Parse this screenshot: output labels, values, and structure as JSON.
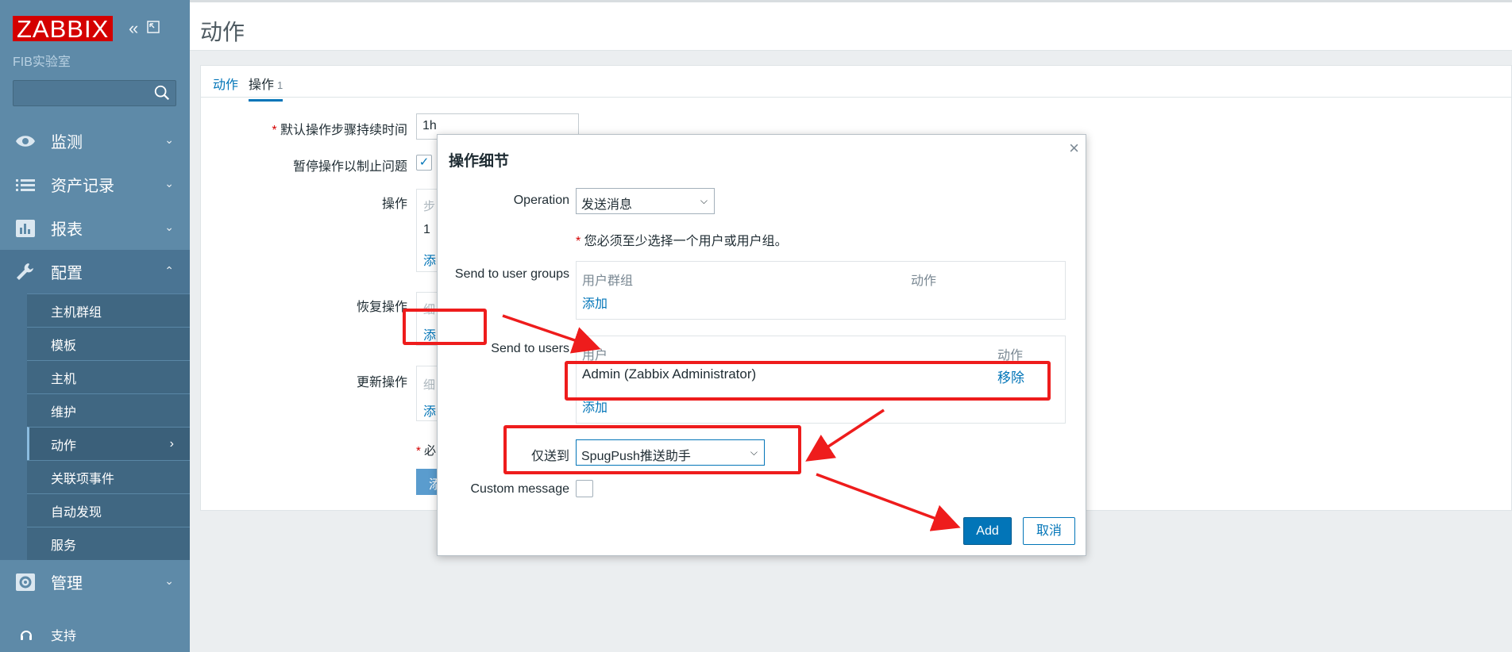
{
  "colors": {
    "sidebar": "#5e8aa8",
    "accent": "#0275b8",
    "logo": "#d40000",
    "annotation": "#ee1c1c"
  },
  "sidebar": {
    "logo": "ZABBIX",
    "server_name": "FIB实验室",
    "search_placeholder": "",
    "menu": [
      {
        "label": "监测",
        "icon": "eye-icon"
      },
      {
        "label": "资产记录",
        "icon": "list-icon"
      },
      {
        "label": "报表",
        "icon": "bar-chart-icon"
      },
      {
        "label": "配置",
        "icon": "wrench-icon"
      }
    ],
    "submenu": [
      "主机群组",
      "模板",
      "主机",
      "维护",
      "动作",
      "关联项事件",
      "自动发现",
      "服务"
    ],
    "admin": {
      "label": "管理",
      "icon": "gear-icon"
    },
    "support": "支持"
  },
  "page": {
    "title": "动作",
    "tabs": [
      {
        "label": "动作"
      },
      {
        "label": "操作",
        "count": "1"
      }
    ],
    "form": {
      "default_duration_label": "默认操作步骤持续时间",
      "default_duration_value": "1h",
      "pause_label": "暂停操作以制止问题",
      "operations_label": "操作",
      "operations_col": "步",
      "operations_row": "1",
      "add_link": "添",
      "recovery_label": "恢复操作",
      "recovery_col": "细",
      "update_label": "更新操作",
      "update_col": "细",
      "required_note": "必",
      "bottom_button": "添"
    }
  },
  "modal": {
    "title": "操作细节",
    "operation_label": "Operation",
    "operation_value": "发送消息",
    "warning": "您必须至少选择一个用户或用户组。",
    "send_groups_label": "Send to user groups",
    "groups_col_group": "用户群组",
    "groups_col_action": "动作",
    "groups_add": "添加",
    "send_users_label": "Send to users",
    "users_col_user": "用户",
    "users_col_action": "动作",
    "user_row_name": "Admin (Zabbix Administrator)",
    "user_row_remove": "移除",
    "users_add": "添加",
    "only_send_label": "仅送到",
    "only_send_value": "SpugPush推送助手",
    "custom_message_label": "Custom message",
    "add_button": "Add",
    "cancel_button": "取消"
  }
}
